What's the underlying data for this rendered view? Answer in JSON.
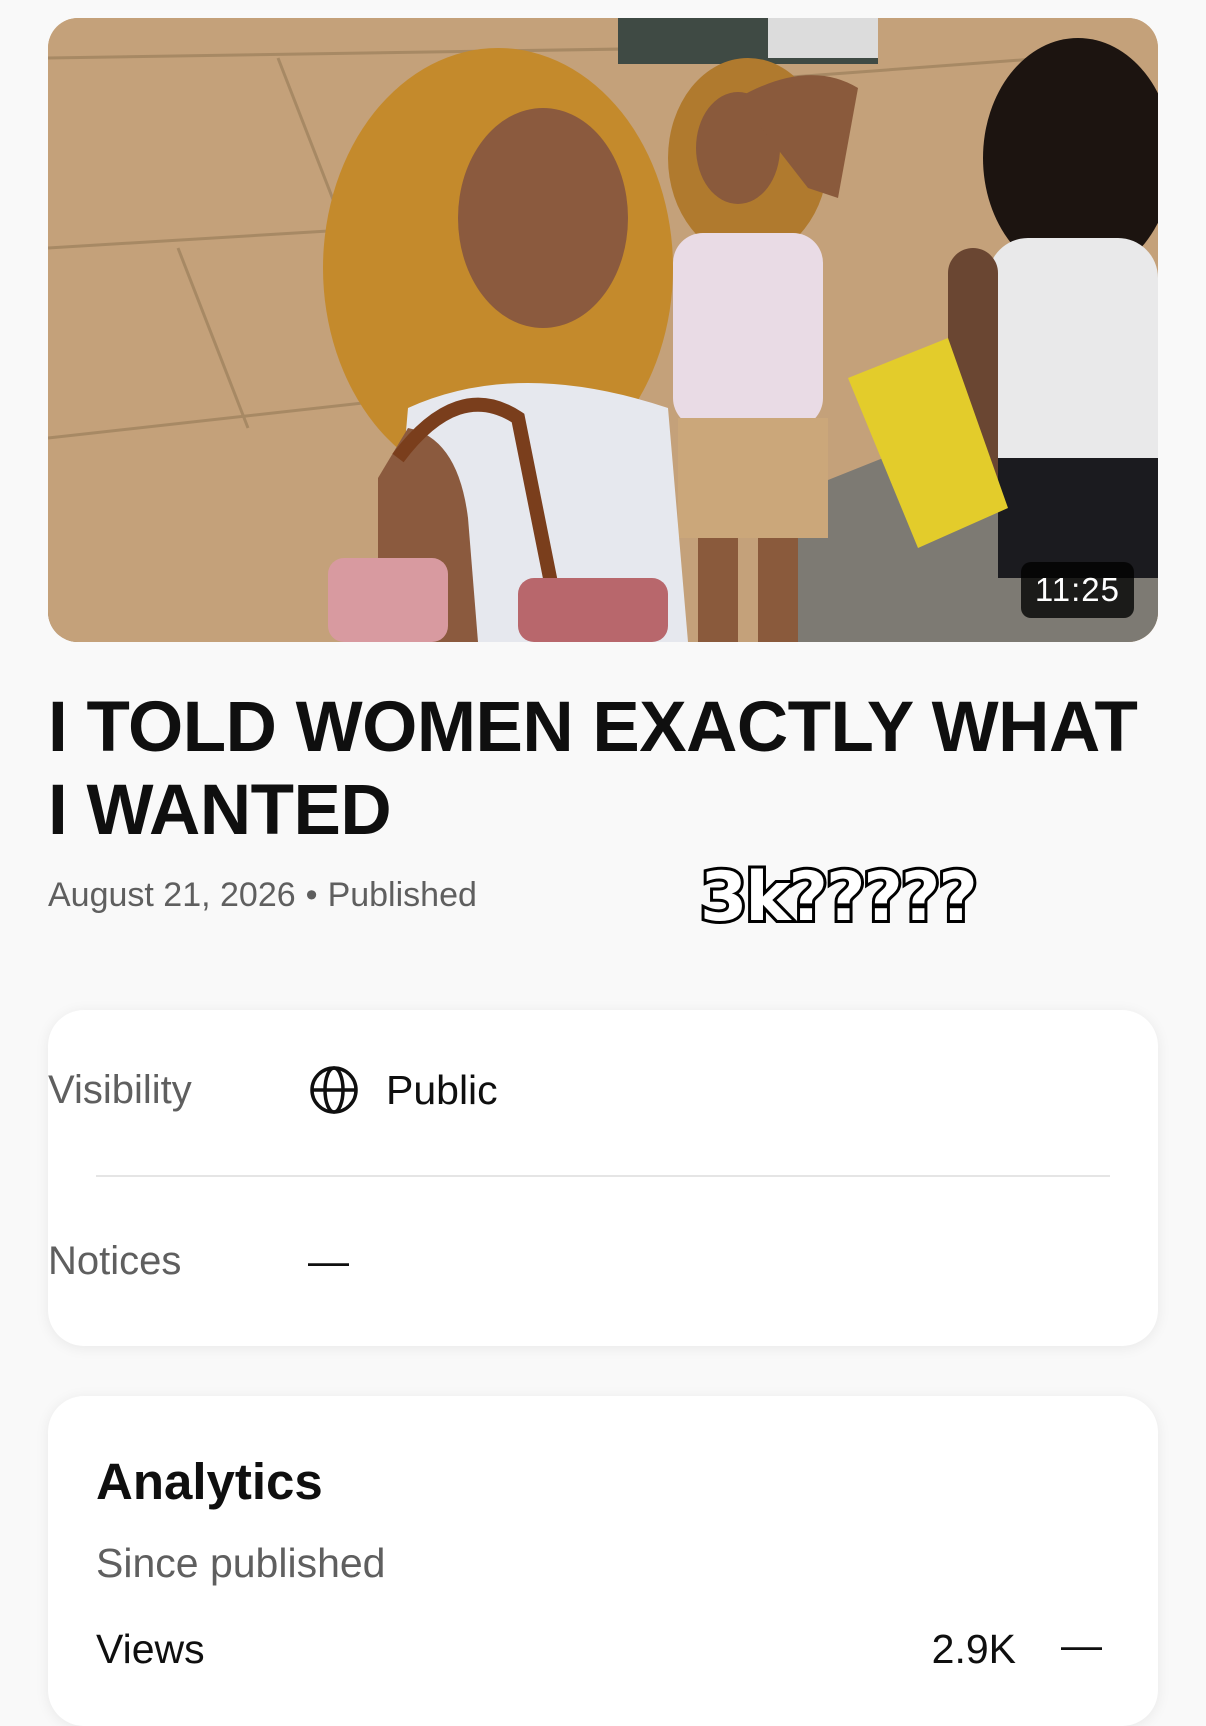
{
  "video": {
    "duration": "11:25",
    "title": "I TOLD WOMEN EXACTLY WHAT I WANTED",
    "date": "August 21, 2026",
    "separator": "•",
    "status": "Published"
  },
  "overlay": {
    "caption": "3k?????"
  },
  "details": {
    "visibility_label": "Visibility",
    "visibility_value": "Public",
    "visibility_icon": "globe-icon",
    "notices_label": "Notices",
    "notices_value": "—"
  },
  "analytics": {
    "title": "Analytics",
    "subtitle": "Since published",
    "views_label": "Views",
    "views_value": "2.9K",
    "views_change": "—"
  }
}
